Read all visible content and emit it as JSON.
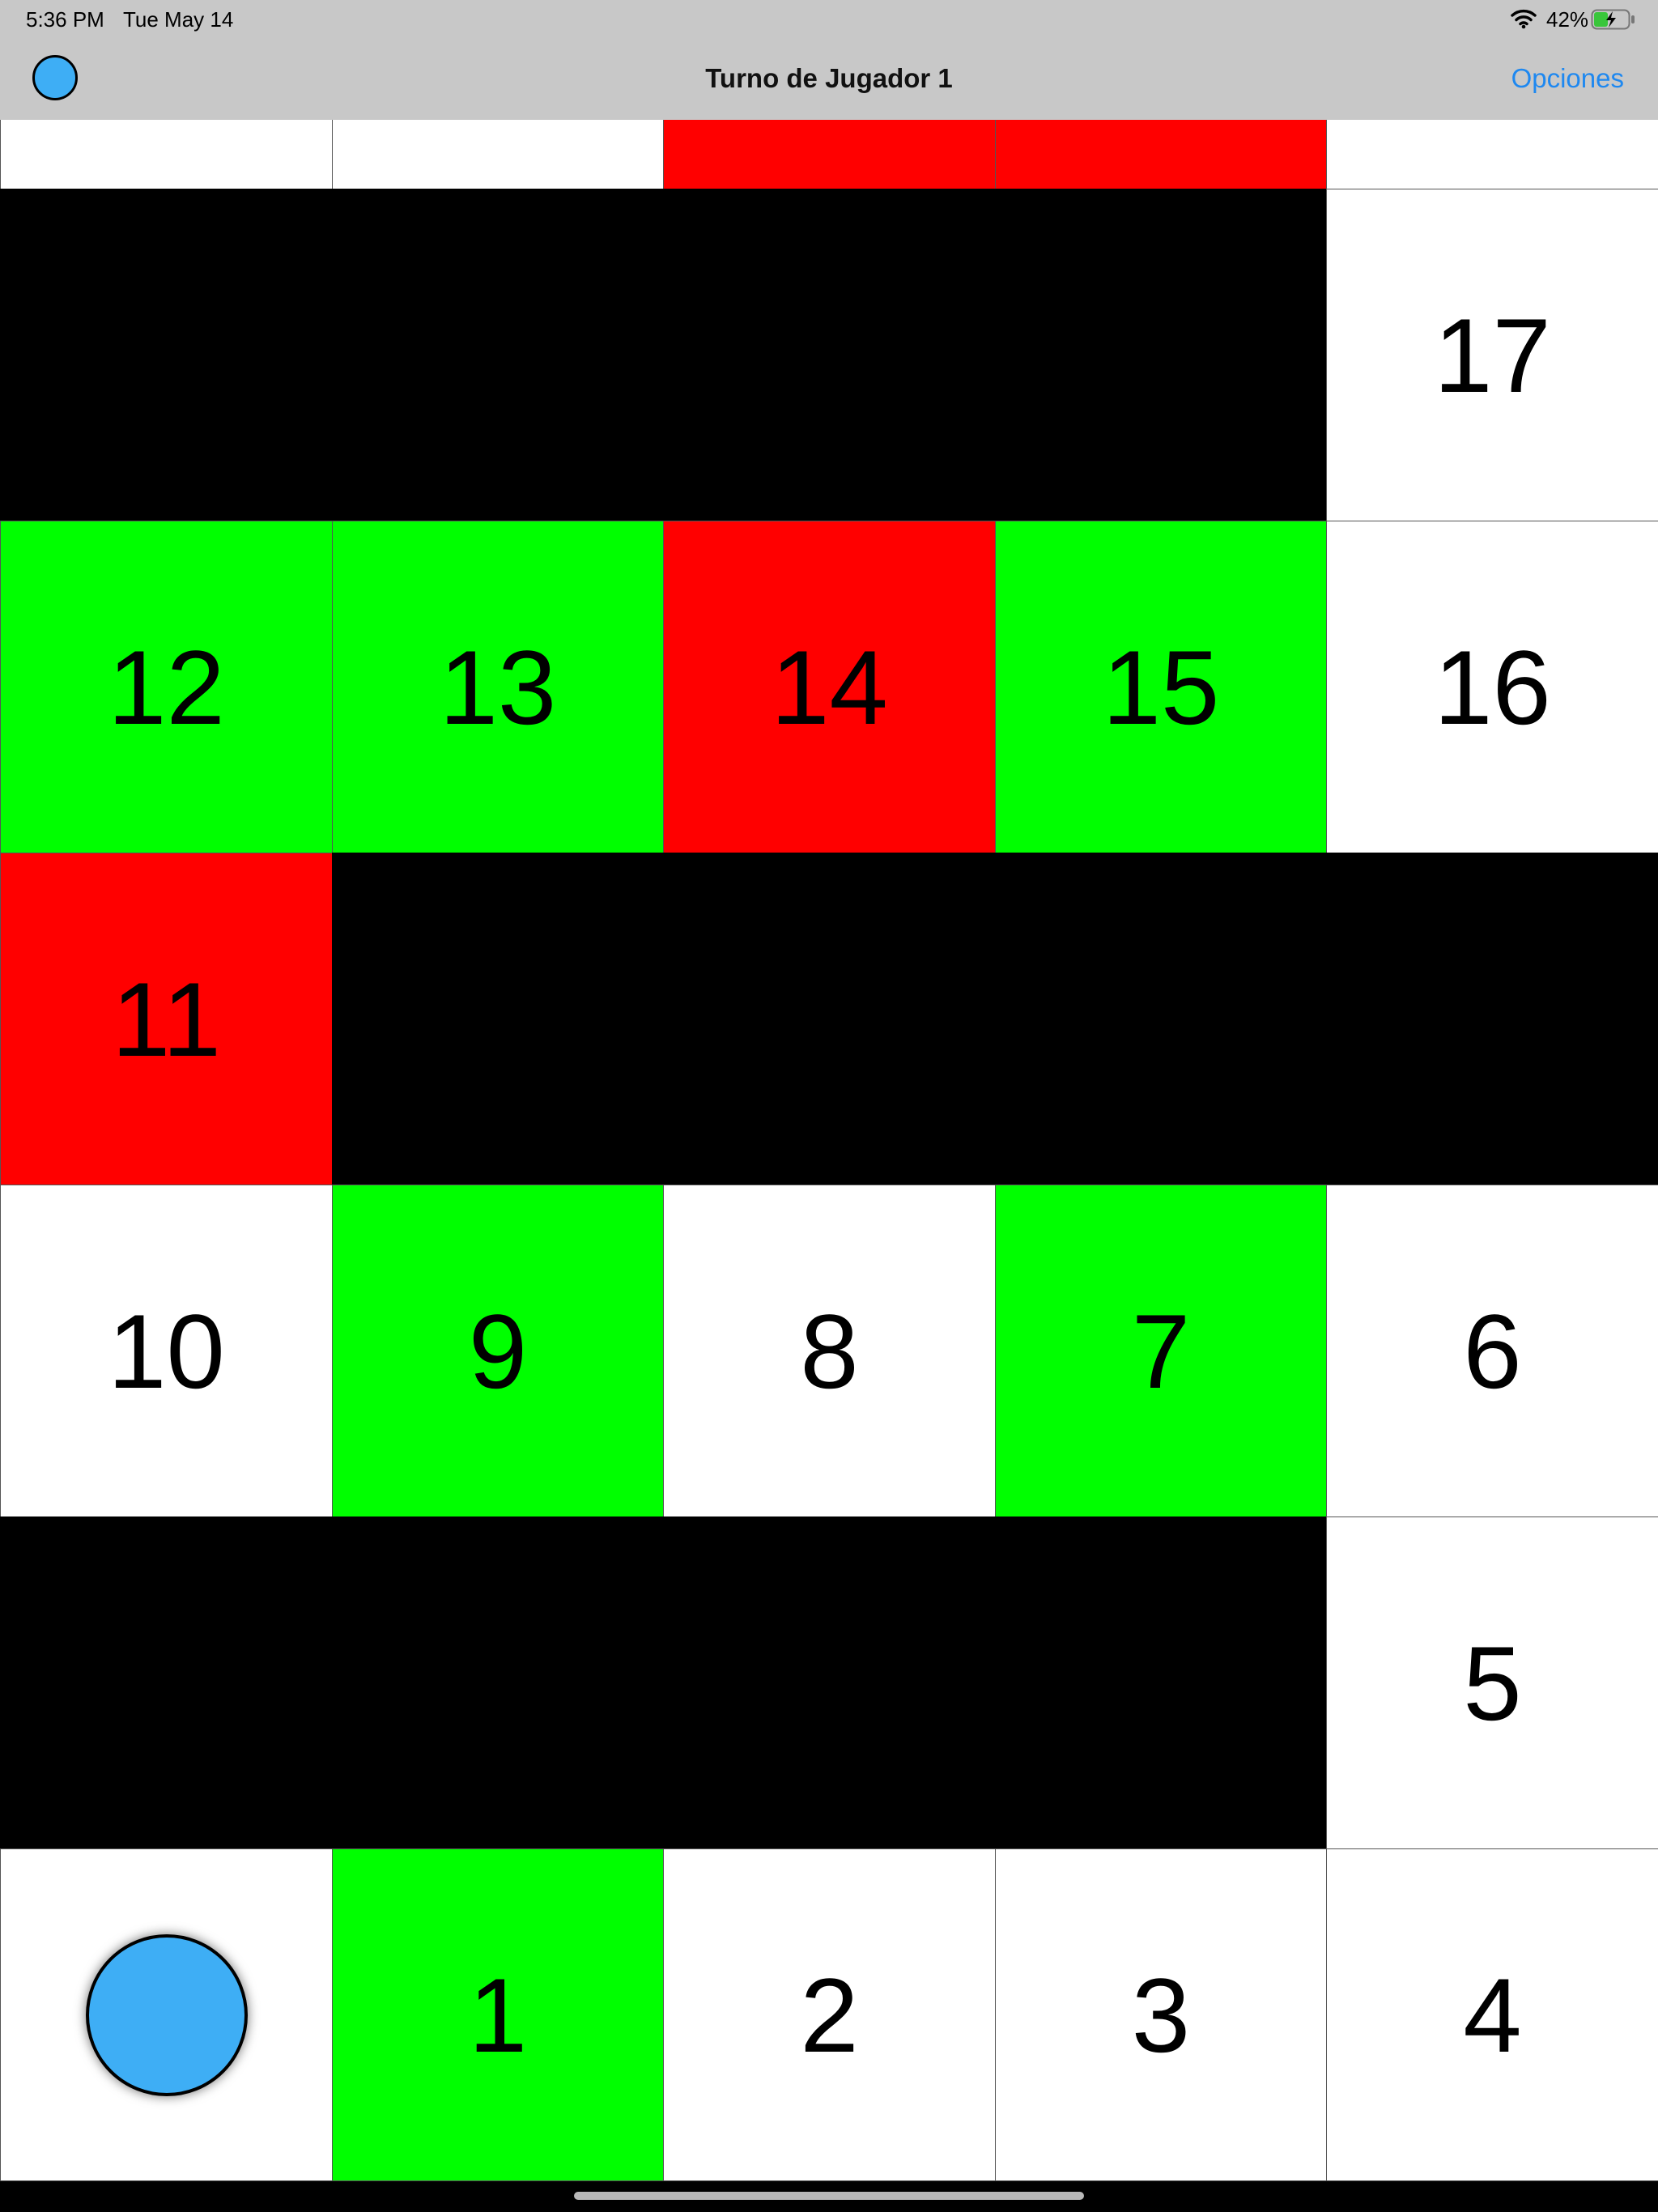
{
  "status_bar": {
    "time": "5:36 PM",
    "date": "Tue May 14",
    "battery_percent": "42%",
    "battery_level": 0.42,
    "charging": true,
    "icons": [
      "wifi-icon",
      "battery-charging-icon"
    ]
  },
  "nav": {
    "title": "Turno de Jugador 1",
    "options_label": "Opciones",
    "current_player_color": "#3eaef5"
  },
  "colors": {
    "safe": "#ffffff",
    "bonus": "#00ff00",
    "penalty": "#ff0000",
    "wall": "#000000",
    "player": "#3eaef5",
    "link": "#1e88f0"
  },
  "board": {
    "rows": [
      [
        {
          "label": "",
          "color": "white"
        },
        {
          "label": "",
          "color": "white"
        },
        {
          "label": "",
          "color": "red"
        },
        {
          "label": "",
          "color": "red"
        },
        {
          "label": "",
          "color": "white"
        }
      ],
      [
        {
          "label": "",
          "color": "black"
        },
        {
          "label": "",
          "color": "black"
        },
        {
          "label": "",
          "color": "black"
        },
        {
          "label": "",
          "color": "black"
        },
        {
          "label": "17",
          "color": "white"
        }
      ],
      [
        {
          "label": "12",
          "color": "green"
        },
        {
          "label": "13",
          "color": "green"
        },
        {
          "label": "14",
          "color": "red"
        },
        {
          "label": "15",
          "color": "green"
        },
        {
          "label": "16",
          "color": "white"
        }
      ],
      [
        {
          "label": "11",
          "color": "red"
        },
        {
          "label": "",
          "color": "black"
        },
        {
          "label": "",
          "color": "black"
        },
        {
          "label": "",
          "color": "black"
        },
        {
          "label": "",
          "color": "black"
        }
      ],
      [
        {
          "label": "10",
          "color": "white"
        },
        {
          "label": "9",
          "color": "green"
        },
        {
          "label": "8",
          "color": "white"
        },
        {
          "label": "7",
          "color": "green"
        },
        {
          "label": "6",
          "color": "white"
        }
      ],
      [
        {
          "label": "",
          "color": "black"
        },
        {
          "label": "",
          "color": "black"
        },
        {
          "label": "",
          "color": "black"
        },
        {
          "label": "",
          "color": "black"
        },
        {
          "label": "5",
          "color": "white"
        }
      ],
      [
        {
          "label": "",
          "color": "white",
          "token": "player-1"
        },
        {
          "label": "1",
          "color": "green"
        },
        {
          "label": "2",
          "color": "white"
        },
        {
          "label": "3",
          "color": "white"
        },
        {
          "label": "4",
          "color": "white"
        }
      ]
    ],
    "player_tokens": [
      {
        "player": "Jugador 1",
        "color": "#3eaef5",
        "square": "start"
      }
    ]
  }
}
